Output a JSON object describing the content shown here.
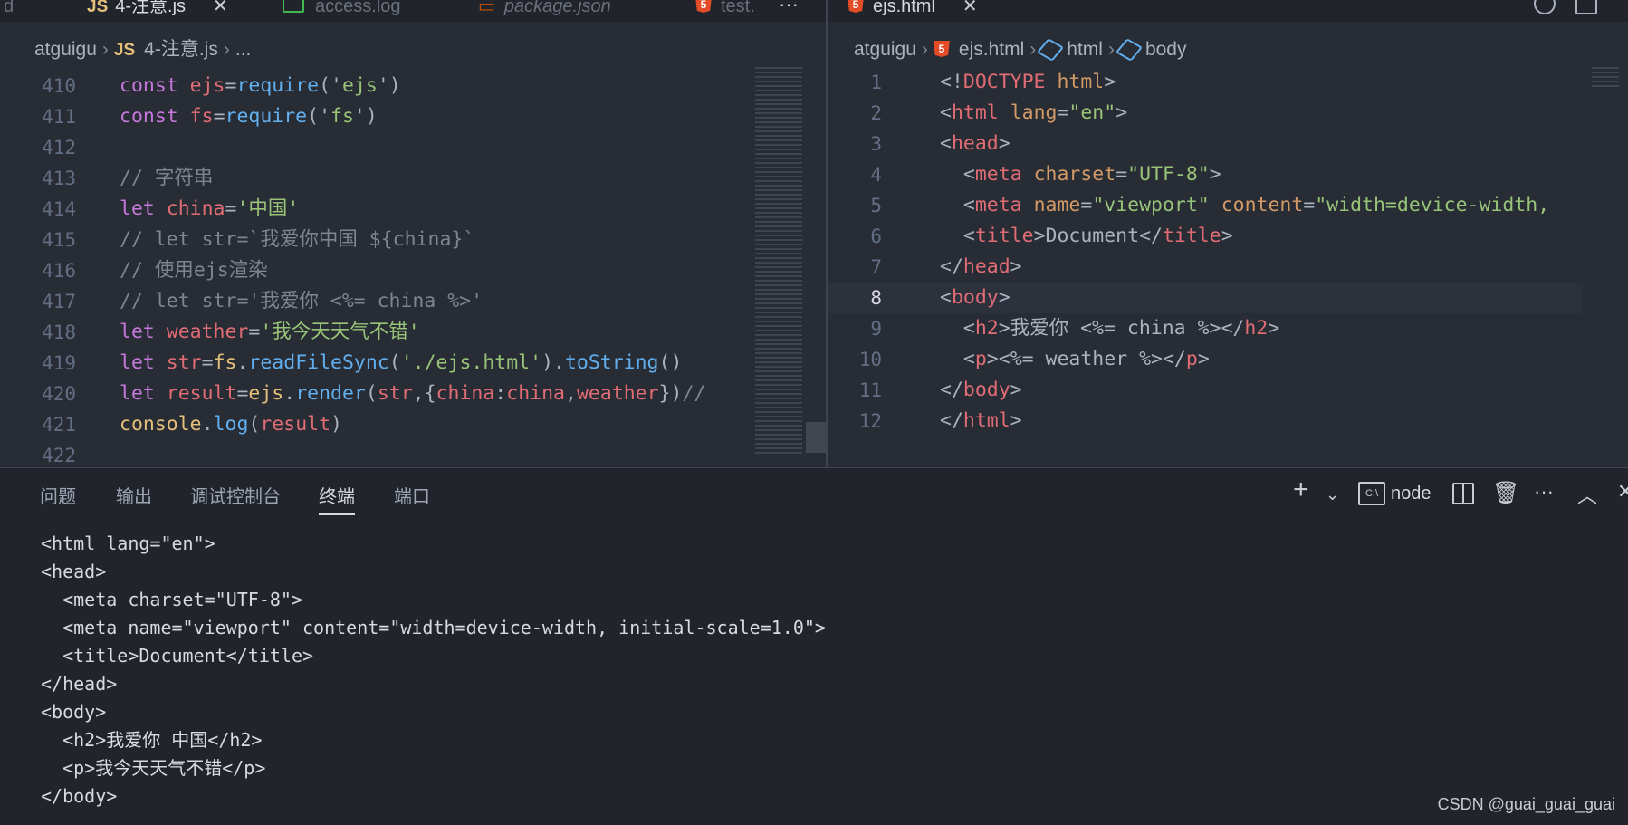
{
  "left_tabs": [
    {
      "label": "d",
      "kind": "partial"
    },
    {
      "label": "4-注意.js",
      "kind": "js",
      "active": true
    },
    {
      "label": "access.log",
      "kind": "log"
    },
    {
      "label": "package.json",
      "kind": "json",
      "italic": true
    },
    {
      "label": "test.",
      "kind": "html"
    }
  ],
  "left_overflow": "···",
  "right_tab": {
    "label": "ejs.html"
  },
  "left_breadcrumb": {
    "root": "atguigu",
    "file": "4-注意.js",
    "rest": "..."
  },
  "right_breadcrumb": {
    "root": "atguigu",
    "file": "ejs.html",
    "node1": "html",
    "node2": "body"
  },
  "left_lines": [
    {
      "n": "410",
      "tokens": [
        [
          "kw",
          "const "
        ],
        [
          "var",
          "ejs"
        ],
        [
          "pun",
          "="
        ],
        [
          "fn",
          "require"
        ],
        [
          "pun",
          "('"
        ],
        [
          "str",
          "ejs"
        ],
        [
          "pun",
          "')"
        ]
      ]
    },
    {
      "n": "411",
      "tokens": [
        [
          "kw",
          "const "
        ],
        [
          "var",
          "fs"
        ],
        [
          "pun",
          "="
        ],
        [
          "fn",
          "require"
        ],
        [
          "pun",
          "('"
        ],
        [
          "str",
          "fs"
        ],
        [
          "pun",
          "')"
        ]
      ]
    },
    {
      "n": "412",
      "tokens": []
    },
    {
      "n": "413",
      "tokens": [
        [
          "cm",
          "// 字符串"
        ]
      ]
    },
    {
      "n": "414",
      "tokens": [
        [
          "kw",
          "let "
        ],
        [
          "var",
          "china"
        ],
        [
          "pun",
          "="
        ],
        [
          "str",
          "'中国'"
        ]
      ]
    },
    {
      "n": "415",
      "tokens": [
        [
          "cm",
          "// let str=`我爱你中国 ${china}`"
        ]
      ]
    },
    {
      "n": "416",
      "tokens": [
        [
          "cm",
          "// 使用ejs渲染"
        ]
      ]
    },
    {
      "n": "417",
      "tokens": [
        [
          "cm",
          "// let str='我爱你 <%= china %>'"
        ]
      ]
    },
    {
      "n": "418",
      "tokens": [
        [
          "kw",
          "let "
        ],
        [
          "var",
          "weather"
        ],
        [
          "pun",
          "="
        ],
        [
          "str",
          "'我今天天气不错'"
        ]
      ]
    },
    {
      "n": "419",
      "tokens": [
        [
          "kw",
          "let "
        ],
        [
          "var",
          "str"
        ],
        [
          "pun",
          "="
        ],
        [
          "cst",
          "fs"
        ],
        [
          "pun",
          "."
        ],
        [
          "fn",
          "readFileSync"
        ],
        [
          "pun",
          "("
        ],
        [
          "str",
          "'./ejs.html'"
        ],
        [
          "pun",
          ")."
        ],
        [
          "fn",
          "toString"
        ],
        [
          "pun",
          "()"
        ]
      ]
    },
    {
      "n": "420",
      "tokens": [
        [
          "kw",
          "let "
        ],
        [
          "var",
          "result"
        ],
        [
          "pun",
          "="
        ],
        [
          "cst",
          "ejs"
        ],
        [
          "pun",
          "."
        ],
        [
          "fn",
          "render"
        ],
        [
          "pun",
          "("
        ],
        [
          "var",
          "str"
        ],
        [
          "pun",
          ",{"
        ],
        [
          "var",
          "china"
        ],
        [
          "pun",
          ":"
        ],
        [
          "var",
          "china"
        ],
        [
          "pun",
          ","
        ],
        [
          "var",
          "weather"
        ],
        [
          "pun",
          "})"
        ],
        [
          "cm",
          "//"
        ]
      ]
    },
    {
      "n": "421",
      "tokens": [
        [
          "cst",
          "console"
        ],
        [
          "pun",
          "."
        ],
        [
          "fn",
          "log"
        ],
        [
          "pun",
          "("
        ],
        [
          "var",
          "result"
        ],
        [
          "pun",
          ")"
        ]
      ]
    },
    {
      "n": "422",
      "tokens": []
    }
  ],
  "right_lines": [
    {
      "n": "1",
      "tokens": [
        [
          "pun",
          "<!"
        ],
        [
          "tag",
          "DOCTYPE "
        ],
        [
          "attr",
          "html"
        ],
        [
          "pun",
          ">"
        ]
      ]
    },
    {
      "n": "2",
      "tokens": [
        [
          "pun",
          "<"
        ],
        [
          "tag",
          "html "
        ],
        [
          "attr",
          "lang"
        ],
        [
          "pun",
          "="
        ],
        [
          "str",
          "\"en\""
        ],
        [
          "pun",
          ">"
        ]
      ]
    },
    {
      "n": "3",
      "tokens": [
        [
          "pun",
          "<"
        ],
        [
          "tag",
          "head"
        ],
        [
          "pun",
          ">"
        ]
      ]
    },
    {
      "n": "4",
      "tokens": [
        [
          "pun",
          "  <"
        ],
        [
          "tag",
          "meta "
        ],
        [
          "attr",
          "charset"
        ],
        [
          "pun",
          "="
        ],
        [
          "str",
          "\"UTF-8\""
        ],
        [
          "pun",
          ">"
        ]
      ]
    },
    {
      "n": "5",
      "tokens": [
        [
          "pun",
          "  <"
        ],
        [
          "tag",
          "meta "
        ],
        [
          "attr",
          "name"
        ],
        [
          "pun",
          "="
        ],
        [
          "str",
          "\"viewport\" "
        ],
        [
          "attr",
          "content"
        ],
        [
          "pun",
          "="
        ],
        [
          "str",
          "\"width=device-width,"
        ]
      ]
    },
    {
      "n": "6",
      "tokens": [
        [
          "pun",
          "  <"
        ],
        [
          "tag",
          "title"
        ],
        [
          "pun",
          ">Document</"
        ],
        [
          "tag",
          "title"
        ],
        [
          "pun",
          ">"
        ]
      ]
    },
    {
      "n": "7",
      "tokens": [
        [
          "pun",
          "</"
        ],
        [
          "tag",
          "head"
        ],
        [
          "pun",
          ">"
        ]
      ]
    },
    {
      "n": "8",
      "tokens": [
        [
          "pun",
          "<"
        ],
        [
          "tag",
          "body"
        ],
        [
          "pun",
          ">"
        ]
      ],
      "current": true
    },
    {
      "n": "9",
      "tokens": [
        [
          "pun",
          "  <"
        ],
        [
          "tag",
          "h2"
        ],
        [
          "pun",
          ">我爱你 <%= china %></"
        ],
        [
          "tag",
          "h2"
        ],
        [
          "pun",
          ">"
        ]
      ]
    },
    {
      "n": "10",
      "tokens": [
        [
          "pun",
          "  <"
        ],
        [
          "tag",
          "p"
        ],
        [
          "pun",
          ">"
        ],
        [
          "pun",
          "<%= weather %></"
        ],
        [
          "tag",
          "p"
        ],
        [
          "pun",
          ">"
        ]
      ]
    },
    {
      "n": "11",
      "tokens": [
        [
          "pun",
          "</"
        ],
        [
          "tag",
          "body"
        ],
        [
          "pun",
          ">"
        ]
      ]
    },
    {
      "n": "12",
      "tokens": [
        [
          "pun",
          "</"
        ],
        [
          "tag",
          "html"
        ],
        [
          "pun",
          ">"
        ]
      ]
    }
  ],
  "panel": {
    "tabs": [
      "问题",
      "输出",
      "调试控制台",
      "终端",
      "端口"
    ],
    "active_tab": "终端",
    "terminal_name": "node",
    "terminal_lines": [
      "<html lang=\"en\">",
      "<head>",
      "  <meta charset=\"UTF-8\">",
      "  <meta name=\"viewport\" content=\"width=device-width, initial-scale=1.0\">",
      "  <title>Document</title>",
      "</head>",
      "<body>",
      "  <h2>我爱你 中国</h2>",
      "  <p>我今天天气不错</p>",
      "</body>"
    ]
  },
  "watermark": "CSDN @guai_guai_guai"
}
